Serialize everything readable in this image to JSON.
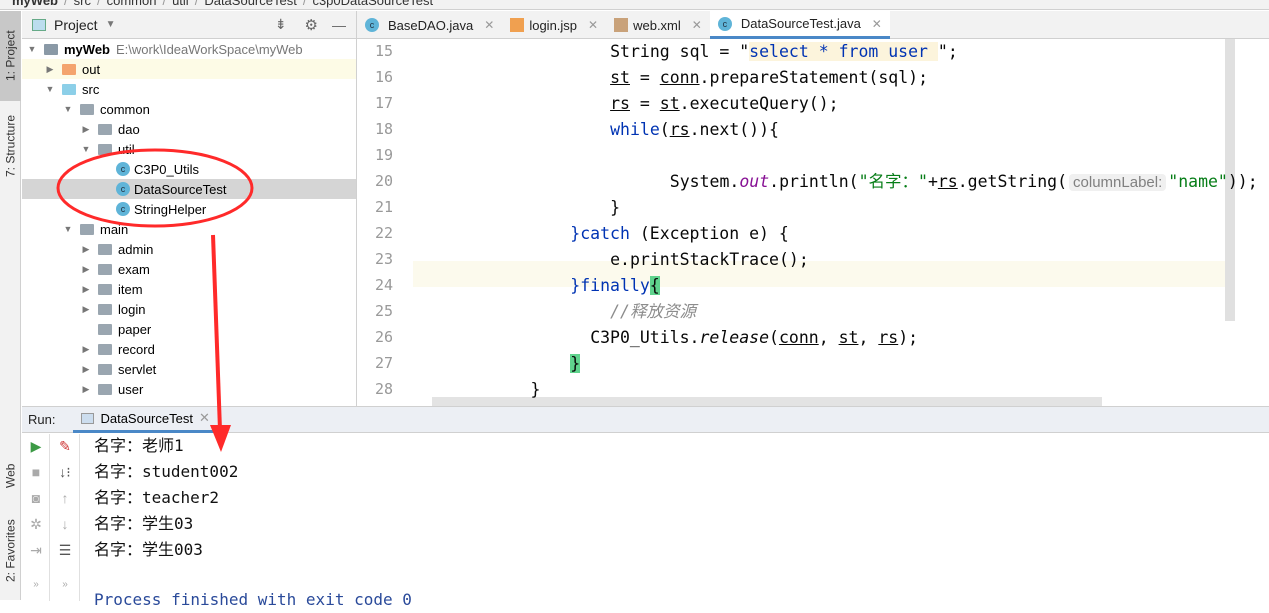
{
  "breadcrumb": [
    "myWeb",
    "src",
    "common",
    "util",
    "DataSourceTest",
    "c3p0DataSourceTest"
  ],
  "left_strip": {
    "project": "1: Project",
    "structure": "7: Structure",
    "web": "Web",
    "favorites": "2: Favorites"
  },
  "project": {
    "title": "Project",
    "root": {
      "name": "myWeb",
      "path": "E:\\work\\IdeaWorkSpace\\myWeb"
    },
    "items": [
      {
        "label": "out",
        "depth": 1,
        "arrow": "right",
        "icon": "folder-orange"
      },
      {
        "label": "src",
        "depth": 1,
        "arrow": "down",
        "icon": "folder-blue"
      },
      {
        "label": "common",
        "depth": 2,
        "arrow": "down",
        "icon": "package"
      },
      {
        "label": "dao",
        "depth": 3,
        "arrow": "right",
        "icon": "package"
      },
      {
        "label": "util",
        "depth": 3,
        "arrow": "down",
        "icon": "package"
      },
      {
        "label": "C3P0_Utils",
        "depth": 4,
        "arrow": "",
        "icon": "class"
      },
      {
        "label": "DataSourceTest",
        "depth": 4,
        "arrow": "",
        "icon": "class-runnable",
        "selected": true
      },
      {
        "label": "StringHelper",
        "depth": 4,
        "arrow": "",
        "icon": "class"
      },
      {
        "label": "main",
        "depth": 2,
        "arrow": "down",
        "icon": "package"
      },
      {
        "label": "admin",
        "depth": 3,
        "arrow": "right",
        "icon": "package"
      },
      {
        "label": "exam",
        "depth": 3,
        "arrow": "right",
        "icon": "package"
      },
      {
        "label": "item",
        "depth": 3,
        "arrow": "right",
        "icon": "package"
      },
      {
        "label": "login",
        "depth": 3,
        "arrow": "right",
        "icon": "package"
      },
      {
        "label": "paper",
        "depth": 3,
        "arrow": "",
        "icon": "package"
      },
      {
        "label": "record",
        "depth": 3,
        "arrow": "right",
        "icon": "package"
      },
      {
        "label": "servlet",
        "depth": 3,
        "arrow": "right",
        "icon": "package"
      },
      {
        "label": "user",
        "depth": 3,
        "arrow": "right",
        "icon": "package"
      }
    ]
  },
  "tabs": [
    {
      "label": "BaseDAO.java",
      "icon": "class"
    },
    {
      "label": "login.jsp",
      "icon": "jsp"
    },
    {
      "label": "web.xml",
      "icon": "xml"
    },
    {
      "label": "DataSourceTest.java",
      "icon": "class-runnable",
      "active": true
    }
  ],
  "code": [
    {
      "n": "15",
      "indent": 9,
      "t": [
        [
          "String sql = \"",
          ""
        ],
        [
          "select * from user ",
          "strh"
        ],
        [
          "\";",
          ""
        ]
      ]
    },
    {
      "n": "16",
      "indent": 9,
      "t": [
        [
          "st",
          "u"
        ],
        [
          " = ",
          ""
        ],
        [
          "conn",
          "u"
        ],
        [
          ".prepareStatement(sql);",
          ""
        ]
      ]
    },
    {
      "n": "17",
      "indent": 9,
      "t": [
        [
          "rs",
          "u"
        ],
        [
          " = ",
          ""
        ],
        [
          "st",
          "u"
        ],
        [
          ".executeQuery();",
          ""
        ]
      ]
    },
    {
      "n": "18",
      "indent": 9,
      "t": [
        [
          "while",
          "kw"
        ],
        [
          "(",
          ""
        ],
        [
          "rs",
          "u"
        ],
        [
          ".next()){",
          ""
        ]
      ]
    },
    {
      "n": "19",
      "indent": 9,
      "t": []
    },
    {
      "n": "20",
      "indent": 12,
      "t": [
        [
          "System.",
          ""
        ],
        [
          "out",
          "it"
        ],
        [
          ".println(",
          ""
        ],
        [
          "\"名字：\"",
          "str"
        ],
        [
          "+",
          ""
        ],
        [
          "rs",
          "u"
        ],
        [
          ".getString(",
          ""
        ],
        [
          "columnLabel:",
          "hint"
        ],
        [
          "\"name\"",
          "str"
        ],
        [
          "));",
          ""
        ]
      ]
    },
    {
      "n": "21",
      "indent": 9,
      "t": [
        [
          "}",
          ""
        ]
      ]
    },
    {
      "n": "22",
      "indent": 7,
      "t": [
        [
          "}",
          "kw"
        ],
        [
          "catch",
          "kw"
        ],
        [
          " (Exception e) {",
          ""
        ]
      ]
    },
    {
      "n": "23",
      "indent": 9,
      "t": [
        [
          "e.printStackTrace();",
          ""
        ]
      ]
    },
    {
      "n": "24",
      "indent": 7,
      "t": [
        [
          "}",
          "kw"
        ],
        [
          "finally",
          "kw"
        ],
        [
          "{",
          "brh"
        ]
      ],
      "current": true
    },
    {
      "n": "25",
      "indent": 9,
      "t": [
        [
          "//释放资源",
          "cm"
        ]
      ]
    },
    {
      "n": "26",
      "indent": 8,
      "t": [
        [
          "C3P0_Utils.",
          ""
        ],
        [
          "release",
          "itf"
        ],
        [
          "(",
          ""
        ],
        [
          "conn",
          "u"
        ],
        [
          ", ",
          ""
        ],
        [
          "st",
          "u"
        ],
        [
          ", ",
          ""
        ],
        [
          "rs",
          "u"
        ],
        [
          ");",
          ""
        ]
      ]
    },
    {
      "n": "27",
      "indent": 7,
      "t": [
        [
          "}",
          "brh"
        ]
      ]
    },
    {
      "n": "28",
      "indent": 5,
      "t": [
        [
          "}",
          ""
        ]
      ]
    }
  ],
  "run": {
    "label": "Run:",
    "tab": "DataSourceTest",
    "output": [
      "名字：老师1",
      "名字：student002",
      "名字：teacher2",
      "名字：学生03",
      "名字：学生003"
    ],
    "footer": "Process finished with exit code 0"
  },
  "colors": {
    "accent": "#4a88c7",
    "annotation": "#ff2a2a"
  }
}
